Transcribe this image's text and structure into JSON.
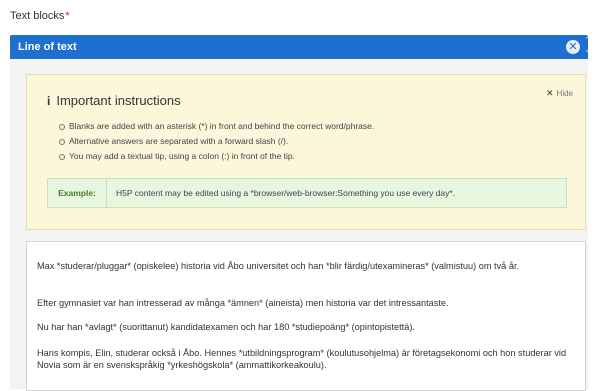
{
  "field": {
    "label": "Text blocks",
    "required_mark": "*"
  },
  "block": {
    "title": "Line of text",
    "remove_icon": "close-circle-icon",
    "move_up": "⌃",
    "move_down": "⌄"
  },
  "instructions": {
    "info_glyph": "i",
    "title": "Important instructions",
    "hide_label": "Hide",
    "items": [
      "Blanks are added with an asterisk (*) in front and behind the correct word/phrase.",
      "Alternative answers are separated with a forward slash (/).",
      "You may add a textual tip, using a colon (:) in front of the tip."
    ],
    "example_label": "Example:",
    "example_text": "H5P content may be edited using a *browser/web-browser:Something you use every day*."
  },
  "text_field": {
    "paragraphs": [
      "Max *studerar/pluggar* (opiskelee) historia vid Åbo universitet och han *blir färdig/utexamineras* (valmistuu) om två år.",
      "Efter gymnasiet var han intresserad av många *ämnen* (aineista) men historia var det intressantaste.",
      "Nu har han *avlagt* (suorittanut) kandidatexamen och har 180 *studiepoäng* (opintopistettä).",
      "Hans kompis, Elin, studerar också i Åbo. Hennes *utbildningsprogram* (koulutusohjelma) är företagsekonomi och hon studerar vid Novia som är en svenskspråkig *yrkeshögskola* (ammattikorkeakoulu)."
    ]
  },
  "colors": {
    "header_blue": "#1f6fcf",
    "instructions_bg": "#fcf7db",
    "example_bg": "#e8f6df",
    "required_red": "#d9232d"
  }
}
